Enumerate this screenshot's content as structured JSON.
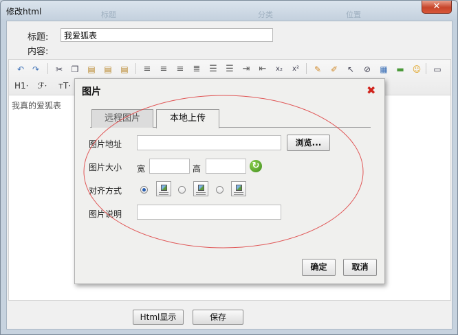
{
  "window": {
    "title": "修改html",
    "close_glyph": "✕",
    "ghost_tabs": [
      "标题",
      "分类",
      "位置"
    ]
  },
  "form": {
    "title_label": "标题:",
    "title_value": "我爱狐表",
    "content_label": "内容:"
  },
  "toolbar": {
    "heading_label": "H1·",
    "font_label": "ℱ·",
    "size_label": "тT·"
  },
  "editor": {
    "text": "我真的爱狐表"
  },
  "dialog": {
    "title": "图片",
    "close_glyph": "✖",
    "tabs": [
      {
        "label": "远程图片",
        "active": false
      },
      {
        "label": "本地上传",
        "active": true
      }
    ],
    "url_label": "图片地址",
    "browse_label": "浏览...",
    "size_label": "图片大小",
    "width_label": "宽",
    "height_label": "高",
    "align_label": "对齐方式",
    "desc_label": "图片说明",
    "ok_label": "确定",
    "cancel_label": "取消"
  },
  "bottom": {
    "html_toggle_label": "Html显示",
    "save_label": "保存"
  },
  "colors": {
    "annotation_ellipse": "#e05555",
    "dialog_close": "#d0231b"
  }
}
